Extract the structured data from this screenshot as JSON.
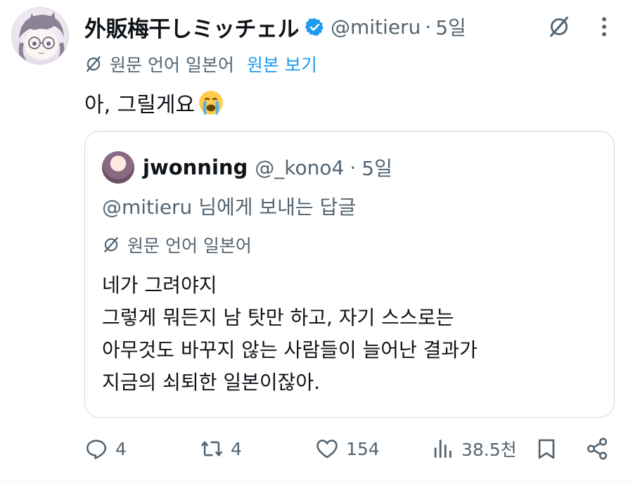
{
  "tweet": {
    "display_name": "外販梅干しミッチェル",
    "handle": "@mitieru",
    "separator": "·",
    "time": "5일",
    "translate_label": "원문 언어 일본어",
    "show_original": "원본 보기",
    "text": "아, 그릴게요"
  },
  "quote": {
    "name": "jwonning",
    "handle": "@_kono4",
    "separator": "·",
    "time": "5일",
    "reply_to": "@mitieru 님에게 보내는 답글",
    "translate_label": "원문 언어 일본어",
    "lines": [
      "네가 그려야지",
      "그렇게 뭐든지 남 탓만 하고, 자기 스스로는",
      "아무것도 바꾸지 않는 사람들이 늘어난 결과가",
      "지금의 쇠퇴한 일본이잖아."
    ]
  },
  "actions": {
    "replies": "4",
    "retweets": "4",
    "likes": "154",
    "views": "38.5천"
  },
  "icons": {
    "verified": "verified-badge-icon",
    "grok": "grok-icon",
    "more": "more-icon",
    "globe": "translate-globe-icon",
    "reply": "reply-icon",
    "retweet": "retweet-icon",
    "like": "heart-icon",
    "views": "views-icon",
    "bookmark": "bookmark-icon",
    "share": "share-icon"
  },
  "colors": {
    "accent": "#1d9bf0",
    "muted": "#536471",
    "border": "#cfd9de"
  }
}
